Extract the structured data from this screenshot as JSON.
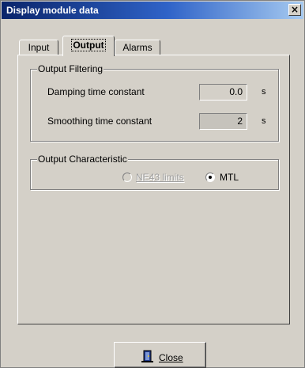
{
  "window": {
    "title": "Display module data",
    "close_glyph": "×"
  },
  "tabs": [
    {
      "label": "Input",
      "active": false
    },
    {
      "label": "Output",
      "active": true
    },
    {
      "label": "Alarms",
      "active": false
    }
  ],
  "output_filtering": {
    "legend": "Output Filtering",
    "damping": {
      "label": "Damping time constant",
      "value": "0.0",
      "unit": "s"
    },
    "smoothing": {
      "label": "Smoothing time constant",
      "value": "2",
      "unit": "s"
    }
  },
  "output_characteristic": {
    "legend": "Output Characteristic",
    "options": [
      {
        "label": "NE43 limits",
        "selected": false,
        "enabled": false
      },
      {
        "label": "MTL",
        "selected": true,
        "enabled": true
      }
    ]
  },
  "close_button": {
    "label": "Close",
    "icon": "door-exit-icon"
  },
  "colors": {
    "face": "#d4d0c8",
    "title_start": "#0a246a",
    "title_end": "#a6caf0"
  }
}
